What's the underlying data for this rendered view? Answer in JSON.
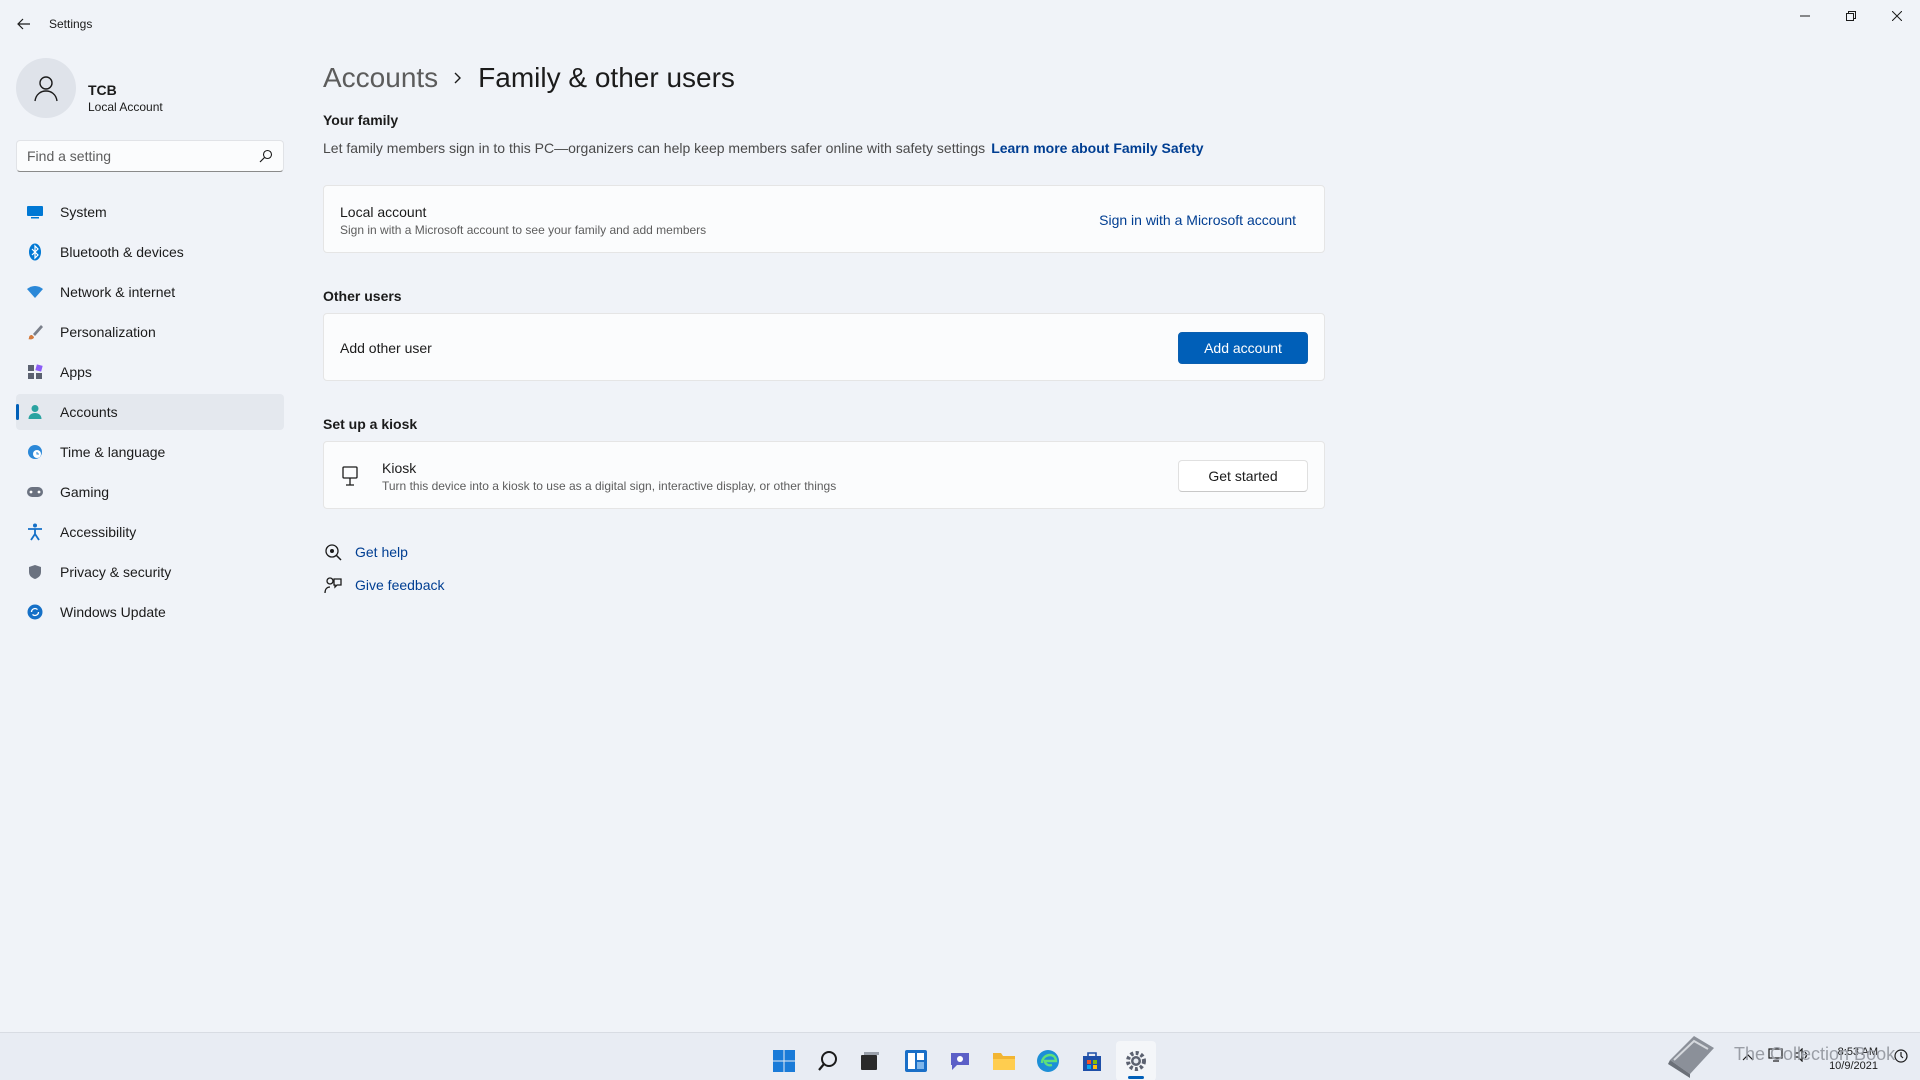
{
  "window": {
    "title": "Settings",
    "back_icon": "back-arrow-icon",
    "controls": [
      "minimize-icon",
      "restore-icon",
      "close-icon"
    ]
  },
  "profile": {
    "name": "TCB",
    "account_type": "Local Account"
  },
  "search": {
    "placeholder": "Find a setting"
  },
  "sidebar": {
    "items": [
      {
        "label": "System",
        "icon": "system-icon",
        "color": "#0078d4"
      },
      {
        "label": "Bluetooth & devices",
        "icon": "bluetooth-icon",
        "color": "#0078d4"
      },
      {
        "label": "Network & internet",
        "icon": "wifi-icon",
        "color": "#2b88d8"
      },
      {
        "label": "Personalization",
        "icon": "brush-icon",
        "color": "#d47a3c"
      },
      {
        "label": "Apps",
        "icon": "apps-icon",
        "color": "#5b6170"
      },
      {
        "label": "Accounts",
        "icon": "person-icon",
        "color": "#2aa3a1",
        "active": true
      },
      {
        "label": "Time & language",
        "icon": "globe-clock-icon",
        "color": "#2b88d8"
      },
      {
        "label": "Gaming",
        "icon": "controller-icon",
        "color": "#6b7280"
      },
      {
        "label": "Accessibility",
        "icon": "accessibility-icon",
        "color": "#1570c7"
      },
      {
        "label": "Privacy & security",
        "icon": "shield-icon",
        "color": "#6b7280"
      },
      {
        "label": "Windows Update",
        "icon": "update-icon",
        "color": "#1570c7"
      }
    ]
  },
  "breadcrumb": {
    "parent": "Accounts",
    "current": "Family & other users"
  },
  "family": {
    "title": "Your family",
    "description": "Let family members sign in to this PC—organizers can help keep members safer online with safety settings",
    "learn_more": "Learn more about Family Safety",
    "card_title": "Local account",
    "card_subtitle": "Sign in with a Microsoft account to see your family and add members",
    "signin_link": "Sign in with a Microsoft account"
  },
  "other_users": {
    "title": "Other users",
    "card_title": "Add other user",
    "button": "Add account"
  },
  "kiosk": {
    "title": "Set up a kiosk",
    "card_title": "Kiosk",
    "card_subtitle": "Turn this device into a kiosk to use as a digital sign, interactive display, or other things",
    "button": "Get started"
  },
  "help": {
    "get_help": "Get help",
    "give_feedback": "Give feedback"
  },
  "taskbar": {
    "icons": [
      "start-icon",
      "search-icon",
      "task-view-icon",
      "widgets-icon",
      "chat-icon",
      "file-explorer-icon",
      "edge-icon",
      "store-icon",
      "settings-icon"
    ],
    "time": "8:53 AM",
    "date": "10/9/2021"
  },
  "watermark": {
    "text": "The Collection Book"
  },
  "colors": {
    "accent": "#005fb8",
    "link": "#003e92",
    "background": "#f0f3f8",
    "card": "#fbfcfd"
  }
}
